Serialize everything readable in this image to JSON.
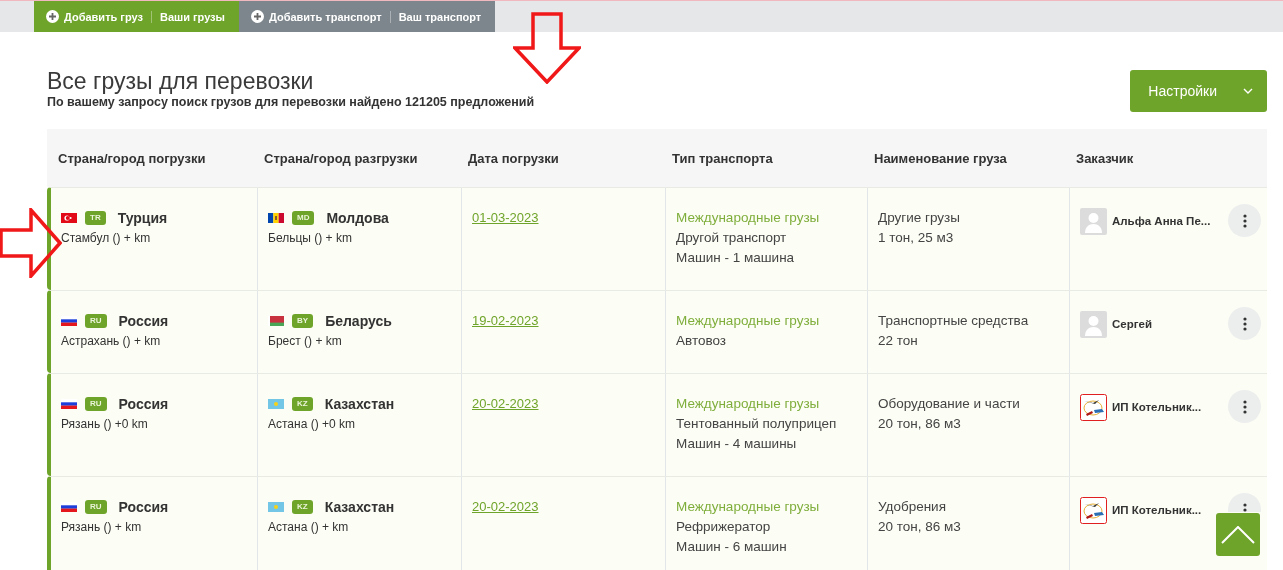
{
  "top_tabs": [
    {
      "kind": "cargo",
      "add": "Добавить груз",
      "mine": "Ваши грузы"
    },
    {
      "kind": "transport",
      "add": "Добавить транспорт",
      "mine": "Ваш транспорт"
    }
  ],
  "title": "Все грузы для перевозки",
  "subtitle": "По вашему запросу поиск грузов для перевозки найдено 121205 предложений",
  "settings_button": "Настройки",
  "table": {
    "columns": [
      "Страна/город погрузки",
      "Страна/город разгрузки",
      "Дата погрузки",
      "Тип транспорта",
      "Наименование груза",
      "Заказчик"
    ],
    "rows": [
      {
        "from": {
          "kind": "tr",
          "code": "TR",
          "country": "Турция",
          "city": "Стамбул () + km"
        },
        "to": {
          "kind": "md",
          "code": "MD",
          "country": "Молдова",
          "city": "Бельцы () + km"
        },
        "date": "01-03-2023",
        "transport": [
          "Международные грузы",
          "Другой транспорт",
          "Машин - 1 машина"
        ],
        "cargo": [
          "Другие грузы",
          "1 тон, 25 м3"
        ],
        "customer": {
          "kind": "placeholder",
          "name": "Альфа Анна Пе..."
        }
      },
      {
        "from": {
          "kind": "ru",
          "code": "RU",
          "country": "Россия",
          "city": "Астрахань () + km"
        },
        "to": {
          "kind": "by",
          "code": "BY",
          "country": "Беларусь",
          "city": "Брест () + km"
        },
        "date": "19-02-2023",
        "transport": [
          "Международные грузы",
          "Автовоз"
        ],
        "cargo": [
          "Транспортные средства",
          "22 тон"
        ],
        "customer": {
          "kind": "placeholder",
          "name": "Сергей"
        }
      },
      {
        "from": {
          "kind": "ru",
          "code": "RU",
          "country": "Россия",
          "city": "Рязань () +0 km"
        },
        "to": {
          "kind": "kz",
          "code": "KZ",
          "country": "Казахстан",
          "city": "Астана () +0 km"
        },
        "date": "20-02-2023",
        "transport": [
          "Международные грузы",
          "Тентованный полуприцеп",
          "Машин - 4 машины"
        ],
        "cargo": [
          "Оборудование и части",
          "20 тон, 86 м3"
        ],
        "customer": {
          "kind": "logo",
          "name": "ИП Котельник..."
        }
      },
      {
        "from": {
          "kind": "ru",
          "code": "RU",
          "country": "Россия",
          "city": "Рязань () + km"
        },
        "to": {
          "kind": "kz",
          "code": "KZ",
          "country": "Казахстан",
          "city": "Астана () + km"
        },
        "date": "20-02-2023",
        "transport": [
          "Международные грузы",
          "Рефрижератор",
          "Машин - 6 машин"
        ],
        "cargo": [
          "Удобрения",
          "20 тон, 86 м3"
        ],
        "customer": {
          "kind": "logo",
          "name": "ИП Котельник..."
        }
      }
    ]
  }
}
